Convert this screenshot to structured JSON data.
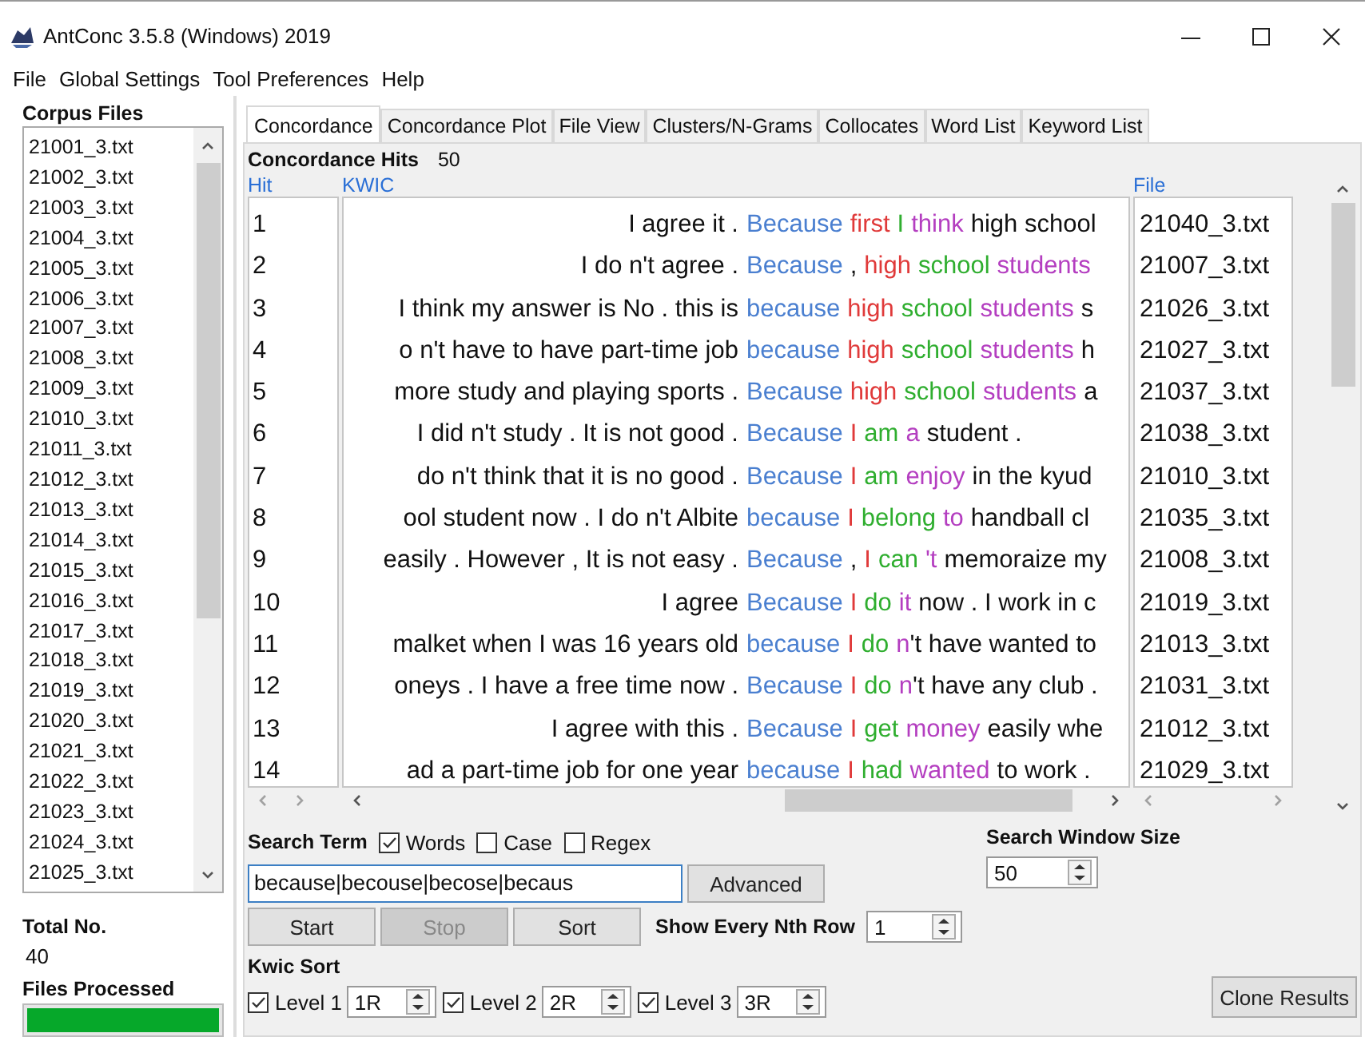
{
  "window": {
    "title": "AntConc 3.5.8 (Windows) 2019"
  },
  "menu": [
    "File",
    "Global Settings",
    "Tool Preferences",
    "Help"
  ],
  "corpus": {
    "heading": "Corpus Files",
    "files": [
      "21001_3.txt",
      "21002_3.txt",
      "21003_3.txt",
      "21004_3.txt",
      "21005_3.txt",
      "21006_3.txt",
      "21007_3.txt",
      "21008_3.txt",
      "21009_3.txt",
      "21010_3.txt",
      "21011_3.txt",
      "21012_3.txt",
      "21013_3.txt",
      "21014_3.txt",
      "21015_3.txt",
      "21016_3.txt",
      "21017_3.txt",
      "21018_3.txt",
      "21019_3.txt",
      "21020_3.txt",
      "21021_3.txt",
      "21022_3.txt",
      "21023_3.txt",
      "21024_3.txt",
      "21025_3.txt"
    ],
    "total_label": "Total No.",
    "total": "40",
    "processed_label": "Files Processed",
    "progress": {
      "level": 1
    }
  },
  "tabs": [
    {
      "label": "Concordance",
      "selected": true
    },
    {
      "label": "Concordance Plot",
      "selected": false
    },
    {
      "label": "File View",
      "selected": false
    },
    {
      "label": "Clusters/N-Grams",
      "selected": false
    },
    {
      "label": "Collocates",
      "selected": false
    },
    {
      "label": "Word List",
      "selected": false
    },
    {
      "label": "Keyword List",
      "selected": false
    }
  ],
  "hits": {
    "label": "Concordance Hits",
    "count": "50"
  },
  "table": {
    "columns": [
      "Hit",
      "KWIC",
      "File"
    ],
    "rows": [
      {
        "hit": "1",
        "left": "I agree it .",
        "right": [
          {
            "kind": "node",
            "text": "Because"
          },
          {
            "kind": "r1",
            "text": "first"
          },
          {
            "kind": "r2",
            "text": "I"
          },
          {
            "kind": "r3",
            "text": "think"
          },
          {
            "kind": "plain",
            "text": "high school"
          }
        ],
        "file": "21040_3.txt"
      },
      {
        "hit": "2",
        "left": "I do n't agree .",
        "right": [
          {
            "kind": "node",
            "text": "Because"
          },
          {
            "kind": "plain",
            "text": ","
          },
          {
            "kind": "r1",
            "text": "high"
          },
          {
            "kind": "r2",
            "text": "school"
          },
          {
            "kind": "r3",
            "text": "students"
          }
        ],
        "file": "21007_3.txt"
      },
      {
        "hit": "3",
        "left": "I think my answer is No . this is",
        "right": [
          {
            "kind": "node",
            "text": "because"
          },
          {
            "kind": "r1",
            "text": "high"
          },
          {
            "kind": "r2",
            "text": "school"
          },
          {
            "kind": "r3",
            "text": "students"
          },
          {
            "kind": "plain",
            "text": "s"
          }
        ],
        "file": "21026_3.txt"
      },
      {
        "hit": "4",
        "left": "o n't have to have part-time job",
        "right": [
          {
            "kind": "node",
            "text": "because"
          },
          {
            "kind": "r1",
            "text": "high"
          },
          {
            "kind": "r2",
            "text": "school"
          },
          {
            "kind": "r3",
            "text": "students"
          },
          {
            "kind": "plain",
            "text": "h"
          }
        ],
        "file": "21027_3.txt"
      },
      {
        "hit": "5",
        "left": "more study and playing sports .",
        "right": [
          {
            "kind": "node",
            "text": "Because"
          },
          {
            "kind": "r1",
            "text": "high"
          },
          {
            "kind": "r2",
            "text": "school"
          },
          {
            "kind": "r3",
            "text": "students"
          },
          {
            "kind": "plain",
            "text": "a"
          }
        ],
        "file": "21037_3.txt"
      },
      {
        "hit": "6",
        "left": "I did n't study . It is not good .",
        "right": [
          {
            "kind": "node",
            "text": "Because"
          },
          {
            "kind": "r1",
            "text": "I"
          },
          {
            "kind": "r2",
            "text": "am"
          },
          {
            "kind": "r3",
            "text": "a"
          },
          {
            "kind": "plain",
            "text": "student ."
          }
        ],
        "file": "21038_3.txt"
      },
      {
        "hit": "7",
        "left": "do n't think that it is no good .",
        "right": [
          {
            "kind": "node",
            "text": "Because"
          },
          {
            "kind": "r1",
            "text": "I"
          },
          {
            "kind": "r2",
            "text": "am"
          },
          {
            "kind": "r3",
            "text": "enjoy"
          },
          {
            "kind": "plain",
            "text": "in the kyud"
          }
        ],
        "file": "21010_3.txt"
      },
      {
        "hit": "8",
        "left": "ool student now . I do n't Albite",
        "right": [
          {
            "kind": "node",
            "text": "because"
          },
          {
            "kind": "r1",
            "text": "I"
          },
          {
            "kind": "r2",
            "text": "belong"
          },
          {
            "kind": "r3",
            "text": "to"
          },
          {
            "kind": "plain",
            "text": "handball cl"
          }
        ],
        "file": "21035_3.txt"
      },
      {
        "hit": "9",
        "left": "easily . However , It is not easy .",
        "right": [
          {
            "kind": "node",
            "text": "Because"
          },
          {
            "kind": "plain",
            "text": ","
          },
          {
            "kind": "r1",
            "text": "I"
          },
          {
            "kind": "r2",
            "text": "can"
          },
          {
            "kind": "r3",
            "text": "'t"
          },
          {
            "kind": "plain",
            "text": "memoraize my"
          }
        ],
        "file": "21008_3.txt"
      },
      {
        "hit": "10",
        "left": "I agree",
        "right": [
          {
            "kind": "node",
            "text": "Because"
          },
          {
            "kind": "r1",
            "text": "I"
          },
          {
            "kind": "r2",
            "text": "do"
          },
          {
            "kind": "r3",
            "text": "it"
          },
          {
            "kind": "plain",
            "text": "now . I work in c"
          }
        ],
        "file": "21019_3.txt"
      },
      {
        "hit": "11",
        "left": "malket when I was 16 years old",
        "right": [
          {
            "kind": "node",
            "text": "because"
          },
          {
            "kind": "r1",
            "text": "I"
          },
          {
            "kind": "r2",
            "text": "do"
          },
          {
            "kind": "r3",
            "text": "n"
          },
          {
            "kind": "glued",
            "text": "'t have wanted to"
          }
        ],
        "file": "21013_3.txt"
      },
      {
        "hit": "12",
        "left": "oneys . I have a free time now .",
        "right": [
          {
            "kind": "node",
            "text": "Because"
          },
          {
            "kind": "r1",
            "text": "I"
          },
          {
            "kind": "r2",
            "text": "do"
          },
          {
            "kind": "r3",
            "text": "n"
          },
          {
            "kind": "glued",
            "text": "'t have any club ."
          }
        ],
        "file": "21031_3.txt"
      },
      {
        "hit": "13",
        "left": "I agree with this .",
        "right": [
          {
            "kind": "node",
            "text": "Because"
          },
          {
            "kind": "r1",
            "text": "I"
          },
          {
            "kind": "r2",
            "text": "get"
          },
          {
            "kind": "r3",
            "text": "money"
          },
          {
            "kind": "plain",
            "text": "easily whe"
          }
        ],
        "file": "21012_3.txt"
      },
      {
        "hit": "14",
        "left": "ad a part-time job for one year",
        "right": [
          {
            "kind": "node",
            "text": "because"
          },
          {
            "kind": "r1",
            "text": "I"
          },
          {
            "kind": "r2",
            "text": "had"
          },
          {
            "kind": "r3",
            "text": "wanted"
          },
          {
            "kind": "plain",
            "text": "to work ."
          }
        ],
        "file": "21029_3.txt"
      }
    ]
  },
  "search": {
    "label": "Search Term",
    "options": [
      {
        "label": "Words",
        "checked": true
      },
      {
        "label": "Case",
        "checked": false
      },
      {
        "label": "Regex",
        "checked": false
      }
    ],
    "value": "because|becouse|becose|becaus",
    "advanced": "Advanced"
  },
  "window_size": {
    "label": "Search Window Size",
    "value": "50"
  },
  "buttons": [
    {
      "label": "Start",
      "disabled": false
    },
    {
      "label": "Stop",
      "disabled": true
    },
    {
      "label": "Sort",
      "disabled": false
    }
  ],
  "nth_row": {
    "label": "Show Every Nth Row",
    "value": "1"
  },
  "kwic_sort": {
    "label": "Kwic Sort",
    "levels": [
      {
        "label": "Level 1",
        "checked": true,
        "value": "1R"
      },
      {
        "label": "Level 2",
        "checked": true,
        "value": "2R"
      },
      {
        "label": "Level 3",
        "checked": true,
        "value": "3R"
      }
    ]
  },
  "clone": "Clone Results"
}
